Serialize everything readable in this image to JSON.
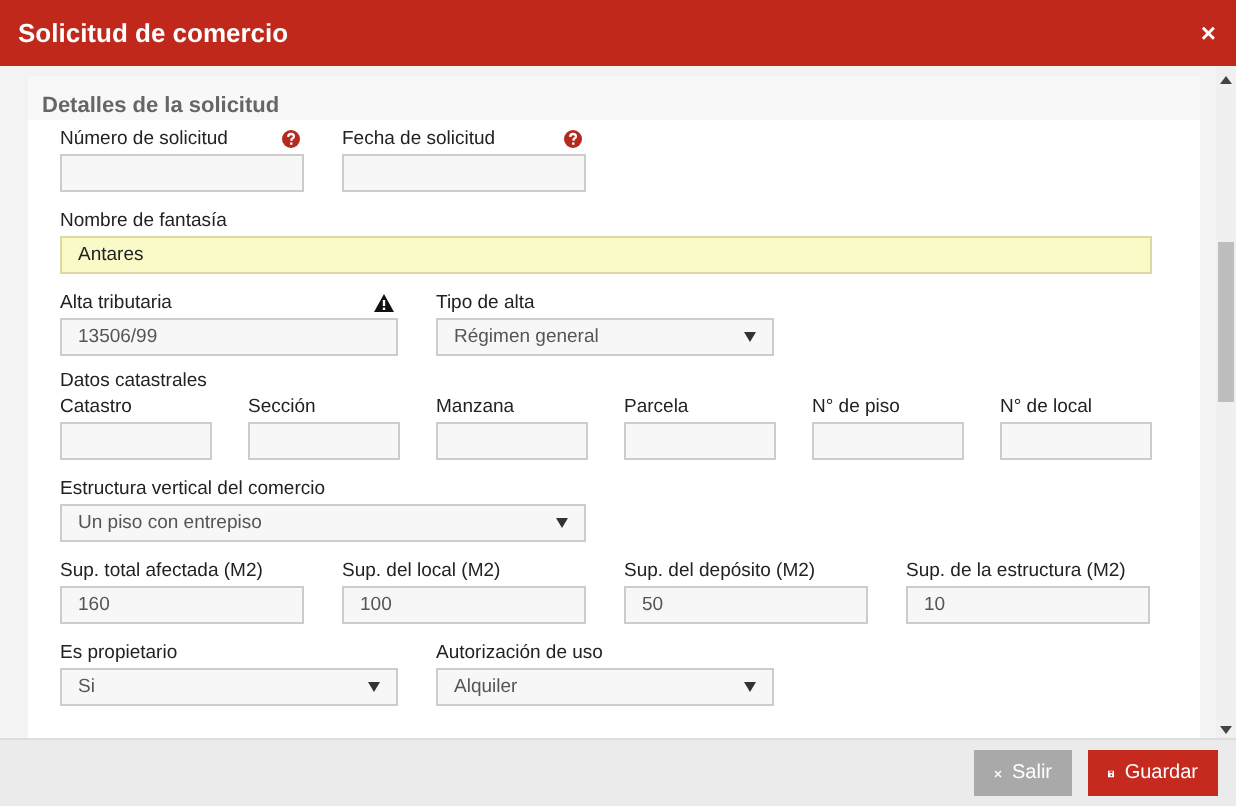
{
  "window": {
    "title": "Solicitud de comercio",
    "close": "×"
  },
  "section": {
    "title": "Detalles de la solicitud"
  },
  "rows": [
    {
      "kind": "narrow",
      "fields": [
        {
          "label": "Número de solicitud",
          "kind": "input",
          "hint": {
            "kind": "help"
          },
          "highlighted": false
        },
        {
          "label": "Fecha de solicitud",
          "kind": "input",
          "hint": {
            "kind": "help"
          },
          "highlighted": false
        }
      ]
    },
    {
      "kind": "full",
      "fields": [
        {
          "label": "Nombre de fantasía",
          "kind": "input",
          "value": "Antares",
          "highlighted": true
        }
      ]
    },
    {
      "kind": "medium",
      "fields": [
        {
          "label": "Alta tributaria",
          "kind": "input",
          "value": "13506/99",
          "hint": {
            "kind": "warning"
          },
          "highlighted": false
        },
        {
          "label": "Tipo de alta",
          "kind": "select",
          "value": "Régimen general",
          "highlighted": false
        }
      ]
    },
    {
      "kind": "small",
      "group": "Datos catastrales",
      "fields": [
        {
          "label": "Catastro",
          "kind": "input",
          "highlighted": false
        },
        {
          "label": "Sección",
          "kind": "input",
          "highlighted": false
        },
        {
          "label": "Manzana",
          "kind": "input",
          "highlighted": false
        },
        {
          "label": "Parcela",
          "kind": "input",
          "highlighted": false
        },
        {
          "label": "N° de piso",
          "kind": "input",
          "highlighted": false
        },
        {
          "label": "N° de local",
          "kind": "input",
          "highlighted": false
        }
      ]
    },
    {
      "kind": "wide",
      "fields": [
        {
          "label": "Estructura vertical del comercio",
          "kind": "select",
          "value": "Un piso con entrepiso",
          "highlighted": false
        }
      ]
    },
    {
      "kind": "narrow",
      "fields": [
        {
          "label": "Sup. total afectada (M2)",
          "kind": "input",
          "value": "160",
          "highlighted": false
        },
        {
          "label": "Sup. del local (M2)",
          "kind": "input",
          "value": "100",
          "highlighted": false
        },
        {
          "label": "Sup. del depósito (M2)",
          "kind": "input",
          "value": "50",
          "highlighted": false
        },
        {
          "label": "Sup. de la estructura (M2)",
          "kind": "input",
          "value": "10",
          "highlighted": false
        }
      ]
    },
    {
      "kind": "medium",
      "fields": [
        {
          "label": "Es propietario",
          "kind": "select",
          "value": "Si",
          "highlighted": false
        },
        {
          "label": "Autorización de uso",
          "kind": "select",
          "value": "Alquiler",
          "highlighted": false
        }
      ]
    }
  ],
  "buttons": [
    {
      "label": "Salir",
      "kind": "cancel"
    },
    {
      "label": "Guardar",
      "kind": "save"
    }
  ]
}
